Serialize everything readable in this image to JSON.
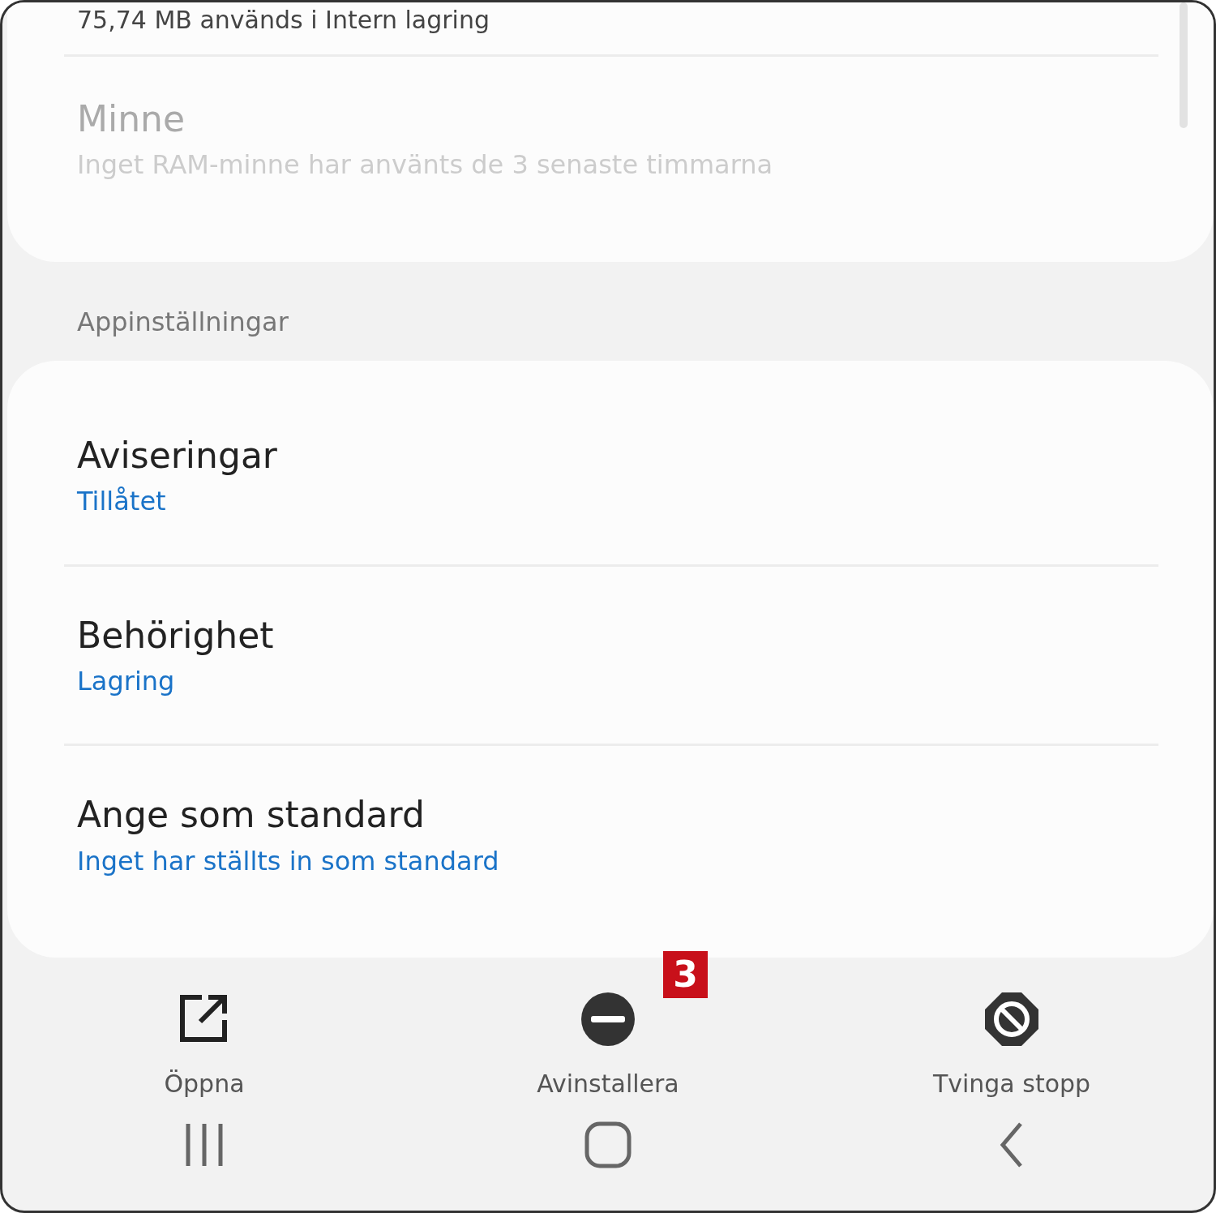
{
  "top_card": {
    "partial_text": "75,74 MB används i Intern lagring",
    "items": [
      {
        "title": "Minne",
        "subtitle": "Inget RAM-minne har använts de 3 senaste timmarna",
        "disabled": true
      }
    ]
  },
  "section_header": "Appinställningar",
  "settings": [
    {
      "title": "Aviseringar",
      "subtitle": "Tillåtet",
      "disabled": false
    },
    {
      "title": "Behörighet",
      "subtitle": "Lagring",
      "disabled": false
    },
    {
      "title": "Ange som standard",
      "subtitle": "Inget har ställts in som standard",
      "disabled": false
    }
  ],
  "actions": [
    {
      "kind": "open",
      "label": "Öppna"
    },
    {
      "kind": "uninstall",
      "label": "Avinstallera",
      "badge": "3"
    },
    {
      "kind": "force_stop",
      "label": "Tvinga stopp"
    }
  ],
  "nav_bar": [
    {
      "kind": "recents"
    },
    {
      "kind": "home"
    },
    {
      "kind": "back"
    }
  ]
}
